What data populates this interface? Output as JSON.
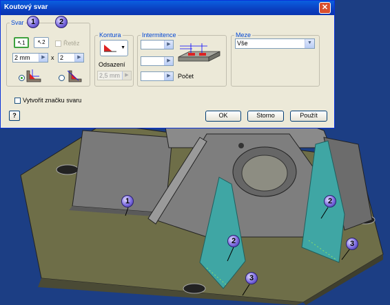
{
  "dialog": {
    "title": "Koutový svar",
    "close_icon": "close-icon",
    "group_svar": {
      "legend": "Svar",
      "select_button_1_label": "1",
      "select_button_2_label": "2",
      "chain_label": "Řetěz",
      "size_1_value": "2 mm",
      "times_symbol": "x",
      "size_2_value": "2"
    },
    "group_kontura": {
      "legend": "Kontura",
      "offset_label": "Odsazení",
      "offset_value": "2,5 mm"
    },
    "group_intermittence": {
      "legend": "Intermitence",
      "field1_value": "",
      "field2_value": "",
      "field3_value": "",
      "count_label": "Počet"
    },
    "group_meze": {
      "legend": "Meze",
      "extent_value": "Vše"
    },
    "create_symbol_label": "Vytvořit značku svaru",
    "ok_label": "OK",
    "cancel_label": "Storno",
    "apply_label": "Použít",
    "help_icon": "help-icon"
  },
  "callouts": {
    "dialog_1": "1",
    "dialog_2": "2",
    "model_1": "1",
    "model_2a": "2",
    "model_2b": "2",
    "model_3a": "3",
    "model_3b": "3"
  }
}
